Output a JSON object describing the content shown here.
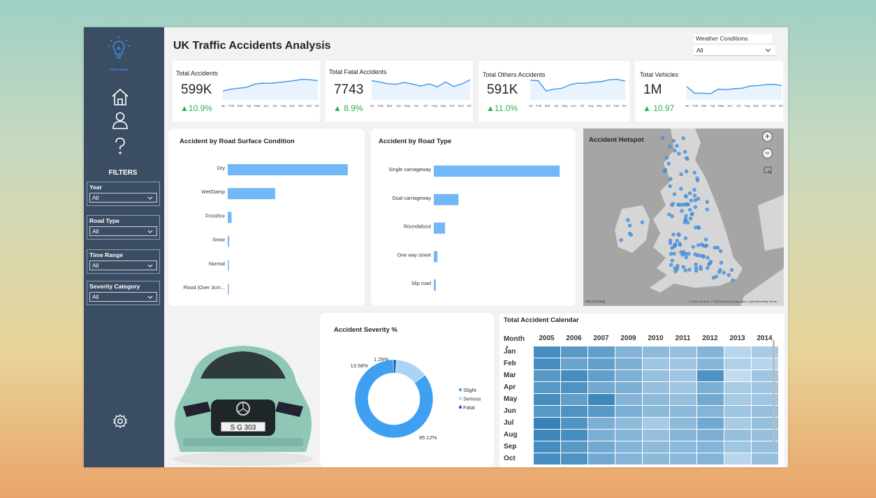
{
  "title": "UK Traffic Accidents Analysis",
  "logo_text": "PRIMO MISSE",
  "sidebar": {
    "nav_icons": [
      "home-icon",
      "user-icon",
      "help-icon"
    ],
    "filters_title": "FILTERS",
    "slicers": [
      {
        "label": "Year",
        "value": "All"
      },
      {
        "label": "Road Type",
        "value": "All"
      },
      {
        "label": "Time Range",
        "value": "All"
      },
      {
        "label": "Severity Category",
        "value": "All"
      }
    ],
    "settings_icon": "gear-icon"
  },
  "weather_slicer": {
    "label": "Weather Conditions",
    "value": "All"
  },
  "kpis": [
    {
      "title": "Total Accidents",
      "value": "599K",
      "delta": "10.9%",
      "spark": [
        40,
        48,
        52,
        56,
        70,
        75,
        74,
        78,
        82,
        86,
        92,
        90,
        86
      ]
    },
    {
      "title": "Total Fatal Accidents",
      "value": "7743",
      "delta": "8.9%",
      "spark": [
        86,
        80,
        72,
        70,
        78,
        70,
        62,
        72,
        58,
        80,
        60,
        72,
        90
      ]
    },
    {
      "title": "Total Others Accidents",
      "value": "591K",
      "delta": "11.0%",
      "spark": [
        88,
        86,
        40,
        48,
        52,
        68,
        75,
        74,
        80,
        82,
        90,
        92,
        84
      ]
    },
    {
      "title": "Total Vehicles",
      "value": "1M",
      "delta": "10.97",
      "spark": [
        60,
        30,
        30,
        28,
        48,
        46,
        50,
        52,
        62,
        64,
        68,
        70,
        64
      ]
    }
  ],
  "months_short": [
    "Jan",
    "Feb",
    "Mar",
    "Apr",
    "May",
    "Jun",
    "Jul",
    "Aug",
    "Sep",
    "Oct",
    "Nov",
    "Dec"
  ],
  "chart_data": [
    {
      "type": "bar",
      "title": "Accident by Road Surface Condition",
      "categories": [
        "Dry",
        "Wet/Damp",
        "Frost/Ice",
        "Snow",
        "Normal",
        "Flood (Over 3cm..."
      ],
      "values": [
        405000,
        160000,
        13000,
        5000,
        500,
        300
      ],
      "xlim": [
        0,
        410000
      ]
    },
    {
      "type": "bar",
      "title": "Accident by Road Type",
      "categories": [
        "Single carriageway",
        "Dual carriageway",
        "Roundabout",
        "One way street",
        "Slip road"
      ],
      "values": [
        448000,
        88000,
        40000,
        13000,
        7000
      ],
      "xlim": [
        0,
        450000
      ]
    },
    {
      "type": "pie",
      "title": "Accident Severity %",
      "categories": [
        "Slight",
        "Serious",
        "Fatal"
      ],
      "values": [
        85.12,
        13.58,
        1.29
      ],
      "labels": [
        "85.12%",
        "13.58%",
        "1.29%"
      ],
      "colors": [
        "#3fa0f2",
        "#a9d3f7",
        "#1f5fb0"
      ]
    },
    {
      "type": "heatmap",
      "title": "Total Accident Calendar",
      "x_header": "Month",
      "columns": [
        "2005",
        "2006",
        "2007",
        "2009",
        "2010",
        "2011",
        "2012",
        "2013",
        "2014"
      ],
      "rows": [
        "Jan",
        "Feb",
        "Mar",
        "Apr",
        "May",
        "Jun",
        "Jul",
        "Aug",
        "Sep",
        "Oct"
      ],
      "values": [
        [
          0.85,
          0.75,
          0.7,
          0.5,
          0.45,
          0.4,
          0.5,
          0.2,
          0.3
        ],
        [
          0.85,
          0.65,
          0.7,
          0.55,
          0.35,
          0.35,
          0.5,
          0.25,
          0.2
        ],
        [
          0.75,
          0.85,
          0.7,
          0.55,
          0.4,
          0.35,
          0.8,
          0.15,
          0.35
        ],
        [
          0.75,
          0.8,
          0.6,
          0.55,
          0.4,
          0.35,
          0.55,
          0.3,
          0.35
        ],
        [
          0.85,
          0.7,
          0.9,
          0.5,
          0.45,
          0.4,
          0.6,
          0.3,
          0.35
        ],
        [
          0.75,
          0.8,
          0.75,
          0.55,
          0.45,
          0.45,
          0.5,
          0.35,
          0.4
        ],
        [
          0.95,
          0.8,
          0.55,
          0.45,
          0.3,
          0.45,
          0.6,
          0.3,
          0.4
        ],
        [
          0.9,
          0.85,
          0.55,
          0.5,
          0.4,
          0.5,
          0.55,
          0.4,
          0.4
        ],
        [
          0.85,
          0.75,
          0.6,
          0.5,
          0.45,
          0.45,
          0.5,
          0.35,
          0.4
        ],
        [
          0.85,
          0.8,
          0.6,
          0.5,
          0.45,
          0.45,
          0.5,
          0.2,
          0.4
        ]
      ]
    }
  ],
  "map": {
    "title": "Accident Hotspot",
    "attribution_left": "Microsoft Bing",
    "attribution_right": "© 2023 TomTom, © 2023 Microsoft Corporation, OpenStreetMap Terms",
    "zoom_in": "+",
    "zoom_out": "−"
  },
  "car_image": {
    "plate": "S G 303"
  }
}
